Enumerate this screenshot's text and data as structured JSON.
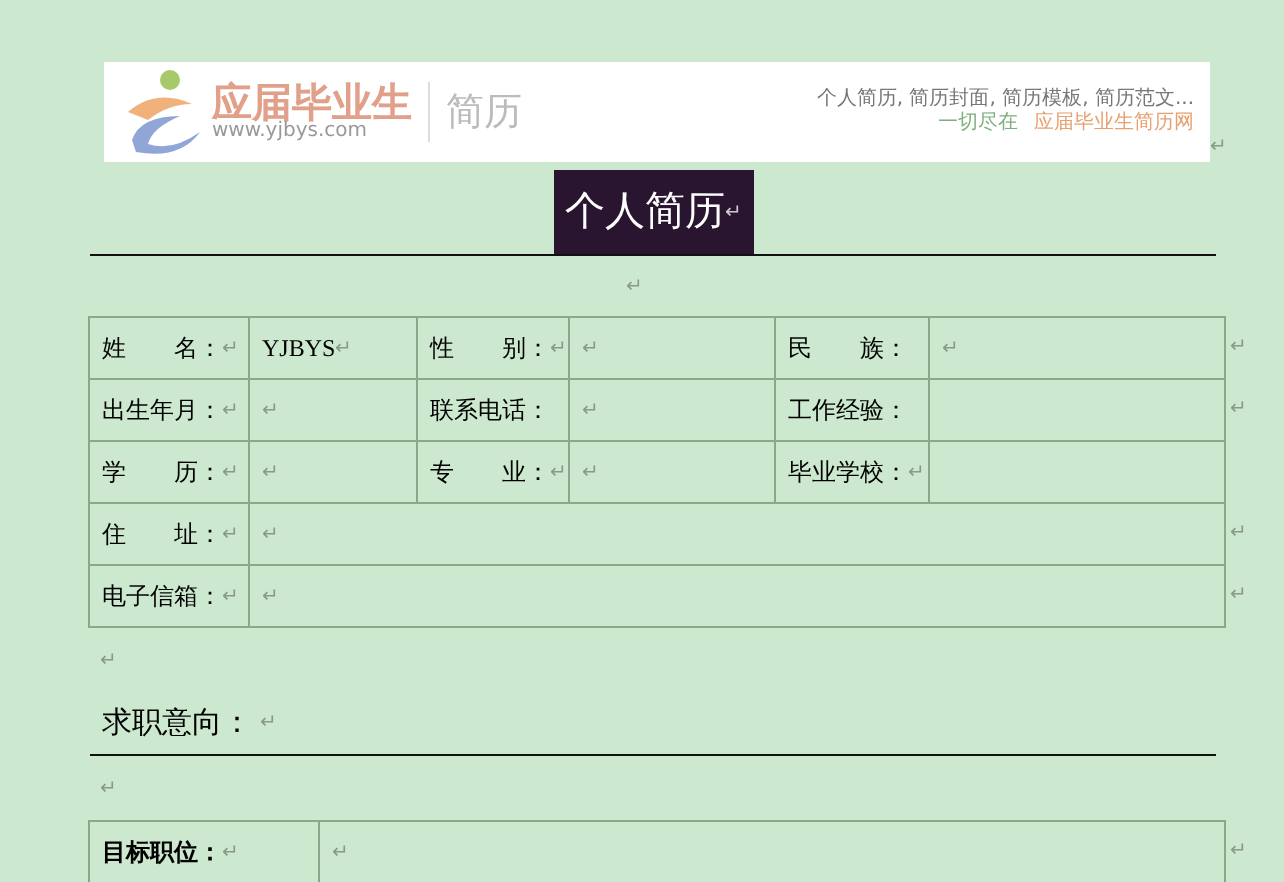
{
  "banner": {
    "logo": "应届毕业生",
    "url": "www.yjbys.com",
    "section": "简历",
    "tagline": "个人简历, 简历封面, 简历模板, 简历范文...",
    "slogan_prefix": "一切尽在",
    "slogan_brand": "应届毕业生简历网",
    "mark": "↵"
  },
  "title": {
    "text": "个人简历",
    "mark": "↵"
  },
  "marks_after_title": [
    "↵"
  ],
  "info_table": {
    "rows": [
      {
        "end_mark": "↵",
        "cells": [
          {
            "kind": "label",
            "text": "姓　　名：",
            "mark": "↵"
          },
          {
            "kind": "value",
            "text": "YJBYS",
            "mark": "↵"
          },
          {
            "kind": "label",
            "text": "性　　别：",
            "mark": "↵"
          },
          {
            "kind": "value",
            "mark": "↵"
          },
          {
            "kind": "label",
            "text": "民　　族："
          },
          {
            "kind": "value",
            "mark": "↵"
          }
        ]
      },
      {
        "end_mark": "↵",
        "cells": [
          {
            "kind": "label",
            "text": "出生年月：",
            "mark": "↵"
          },
          {
            "kind": "value",
            "mark": "↵"
          },
          {
            "kind": "label",
            "text": "联系电话："
          },
          {
            "kind": "value",
            "mark": "↵"
          },
          {
            "kind": "label",
            "text": "工作经验："
          },
          {
            "kind": "value"
          }
        ]
      },
      {
        "cells": [
          {
            "kind": "label",
            "text": "学　　历：",
            "mark": "↵"
          },
          {
            "kind": "value",
            "mark": "↵"
          },
          {
            "kind": "label",
            "text": "专　　业：",
            "mark": "↵"
          },
          {
            "kind": "value",
            "mark": "↵"
          },
          {
            "kind": "label",
            "text": "毕业学校：",
            "mark": "↵"
          },
          {
            "kind": "value"
          }
        ]
      },
      {
        "end_mark": "↵",
        "cells": [
          {
            "kind": "label",
            "text": "住　　址：",
            "mark": "↵"
          },
          {
            "kind": "wide",
            "mark": "↵",
            "colspan": 5
          }
        ]
      },
      {
        "end_mark": "↵",
        "cells": [
          {
            "kind": "label",
            "text": "电子信箱：",
            "mark": "↵"
          },
          {
            "kind": "wide",
            "mark": "↵",
            "colspan": 5
          }
        ]
      }
    ]
  },
  "blank_mark": "↵",
  "section": {
    "heading": "求职意向：",
    "mark": "↵",
    "after_mark": "↵"
  },
  "target_table": {
    "end_mark": "↵",
    "cells": [
      {
        "kind": "label",
        "text": "目标职位：",
        "mark": "↵",
        "bold": true
      },
      {
        "kind": "value",
        "mark": "↵"
      }
    ]
  }
}
